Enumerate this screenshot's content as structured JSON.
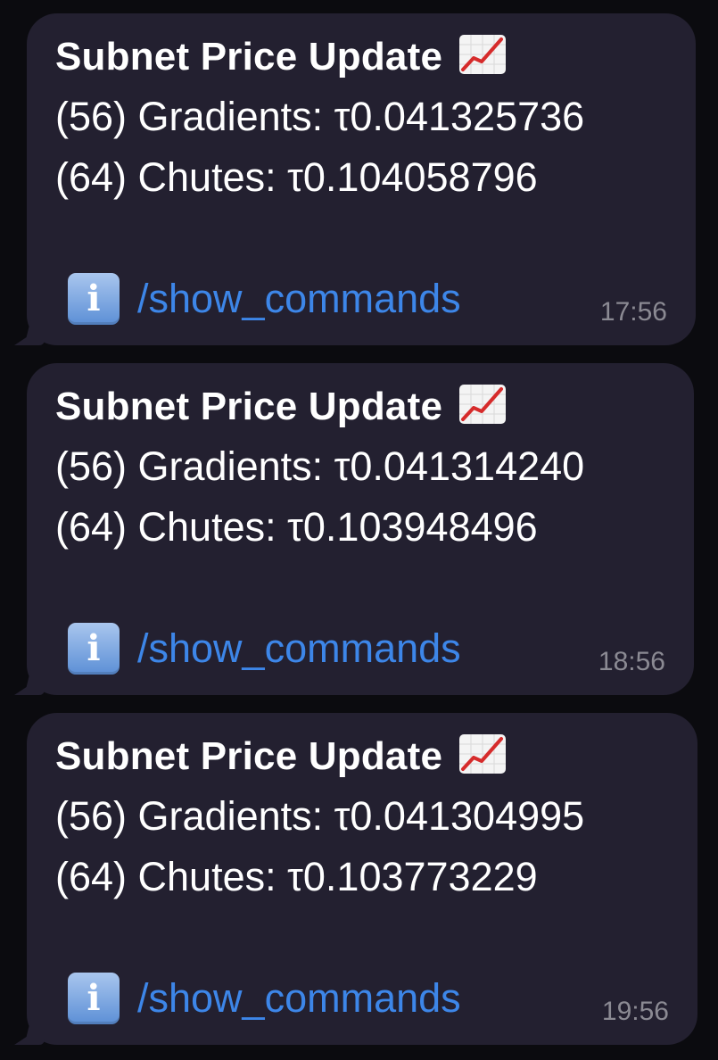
{
  "messages": [
    {
      "title": "Subnet Price Update",
      "icon": "chart-increasing-icon",
      "lines": [
        "(56) Gradients: τ0.041325736",
        "(64) Chutes: τ0.104058796"
      ],
      "info_icon": "information-icon",
      "command": "/show_commands",
      "time": "17:56"
    },
    {
      "title": "Subnet Price Update",
      "icon": "chart-increasing-icon",
      "lines": [
        "(56) Gradients: τ0.041314240",
        "(64) Chutes: τ0.103948496"
      ],
      "info_icon": "information-icon",
      "command": "/show_commands",
      "time": "18:56"
    },
    {
      "title": "Subnet Price Update",
      "icon": "chart-increasing-icon",
      "lines": [
        "(56) Gradients: τ0.041304995",
        "(64) Chutes: τ0.103773229"
      ],
      "info_icon": "information-icon",
      "command": "/show_commands",
      "time": "19:56"
    }
  ],
  "colors": {
    "bubble": "#232030",
    "link": "#3d86e8",
    "time": "#8b8a93",
    "chart_line": "#d62b2b"
  }
}
